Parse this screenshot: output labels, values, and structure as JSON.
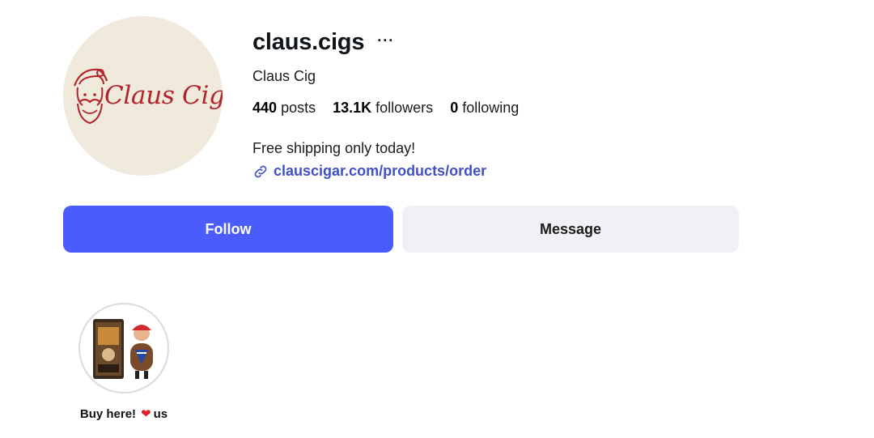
{
  "profile": {
    "avatar_logo_text": "Claus Cig",
    "username": "claus.cigs",
    "more_label": "···",
    "full_name": "Claus Cig",
    "stats": [
      {
        "count": "440",
        "label": "posts"
      },
      {
        "count": "13.1K",
        "label": "followers"
      },
      {
        "count": "0",
        "label": "following"
      }
    ],
    "bio": "Free shipping only today!",
    "link": "clauscigar.com/products/order"
  },
  "actions": {
    "follow_label": "Follow",
    "message_label": "Message"
  },
  "highlights": [
    {
      "label_before": "Buy here!",
      "emoji": "❤",
      "label_after": "us"
    }
  ],
  "colors": {
    "follow_bg": "#4a5cfb",
    "message_bg": "#eff1f5",
    "link": "#4150c8",
    "avatar_bg": "#efeadb",
    "logo_red": "#b3232b"
  }
}
